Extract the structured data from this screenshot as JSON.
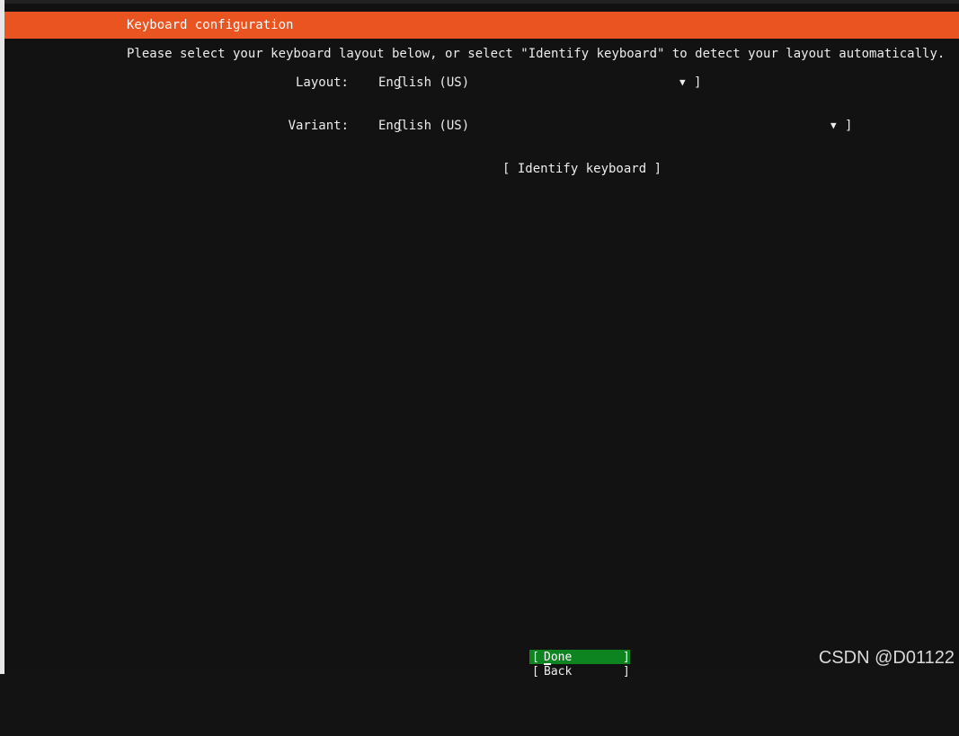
{
  "header": {
    "title": "Keyboard configuration"
  },
  "instruction": "Please select your keyboard layout below, or select \"Identify keyboard\" to detect your layout automatically.",
  "layout": {
    "label": "Layout:",
    "value": "English (US)"
  },
  "variant": {
    "label": "Variant:",
    "value": "English (US)"
  },
  "glyphs": {
    "left_bracket": "[",
    "right_bracket": "]",
    "dropdown_arrow": "▼"
  },
  "identify_button": "[ Identify keyboard ]",
  "done_button": {
    "label": "Done"
  },
  "back_button": {
    "label": "Back"
  },
  "watermark": "CSDN @D01122",
  "colors": {
    "header_accent": "#e95420",
    "selected_button": "#0e8420",
    "background": "#121212"
  }
}
